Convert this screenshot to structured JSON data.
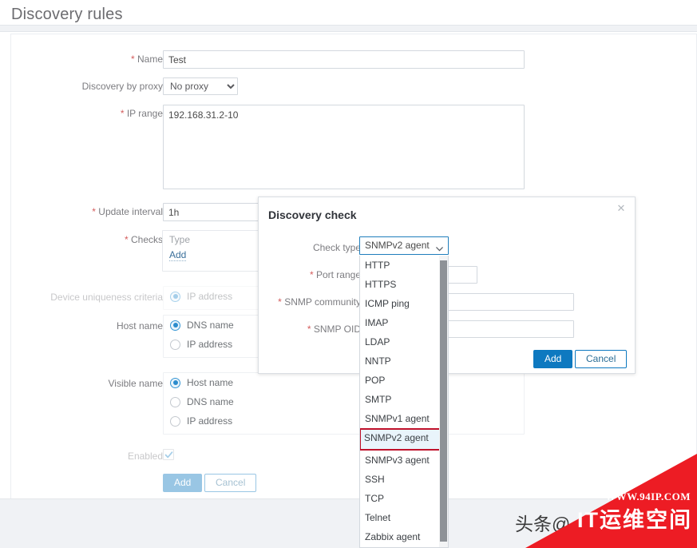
{
  "page": {
    "title": "Discovery rules"
  },
  "form": {
    "fields": {
      "name": {
        "label": "Name",
        "required": true,
        "value": "Test"
      },
      "proxy": {
        "label": "Discovery by proxy",
        "required": false,
        "value": "No proxy",
        "options": [
          "No proxy"
        ]
      },
      "ip_range": {
        "label": "IP range",
        "required": true,
        "value": "192.168.31.2-10"
      },
      "update_interval": {
        "label": "Update interval",
        "required": true,
        "value": "1h"
      },
      "checks": {
        "label": "Checks",
        "required": true,
        "type_header": "Type",
        "add_link": "Add"
      },
      "device_uniqueness": {
        "label": "Device uniqueness criteria",
        "required": false,
        "options": [
          {
            "label": "IP address",
            "selected": true
          }
        ]
      },
      "host_name": {
        "label": "Host name",
        "required": false,
        "options": [
          {
            "label": "DNS name",
            "selected": true
          },
          {
            "label": "IP address",
            "selected": false
          }
        ]
      },
      "visible_name": {
        "label": "Visible name",
        "required": false,
        "options": [
          {
            "label": "Host name",
            "selected": true
          },
          {
            "label": "DNS name",
            "selected": false
          },
          {
            "label": "IP address",
            "selected": false
          }
        ]
      },
      "enabled": {
        "label": "Enabled",
        "checked": true
      }
    },
    "buttons": {
      "add": "Add",
      "cancel": "Cancel"
    }
  },
  "modal": {
    "title": "Discovery check",
    "close_icon": "close-icon",
    "fields": {
      "check_type": {
        "label": "Check type",
        "required": false,
        "value": "SNMPv2 agent"
      },
      "port_range": {
        "label": "Port range",
        "required": true,
        "value": ""
      },
      "snmp_community": {
        "label": "SNMP community",
        "required": true,
        "value": ""
      },
      "snmp_oid": {
        "label": "SNMP OID",
        "required": true,
        "value": ""
      }
    },
    "buttons": {
      "add": "Add",
      "cancel": "Cancel"
    }
  },
  "dropdown": {
    "open": true,
    "selected": "SNMPv2 agent",
    "options": [
      "HTTP",
      "HTTPS",
      "ICMP ping",
      "IMAP",
      "LDAP",
      "NNTP",
      "POP",
      "SMTP",
      "SNMPv1 agent",
      "SNMPv2 agent",
      "SNMPv3 agent",
      "SSH",
      "TCP",
      "Telnet",
      "Zabbix agent"
    ]
  },
  "watermark": {
    "url": "WWW.94IP.COM",
    "brand": "IT运维空间",
    "overlay_text": "头条@",
    "triangle_color": "#ed1c24"
  },
  "colors": {
    "accent": "#0e79c0",
    "required_star": "#d45c5c",
    "highlight_border": "#c0122b",
    "highlight_bg": "#e9f4fb",
    "label_text": "#7c7c80"
  }
}
